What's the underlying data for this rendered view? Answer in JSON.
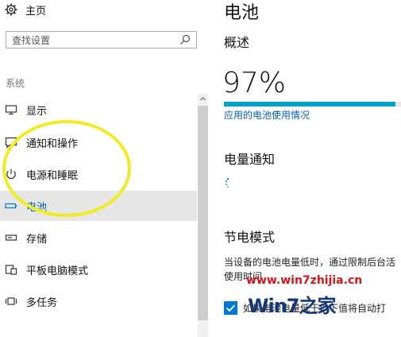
{
  "sidebar": {
    "home_label": "主页",
    "search_placeholder": "查找设置",
    "section_label": "系统",
    "items": [
      {
        "label": "显示",
        "icon": "monitor-icon"
      },
      {
        "label": "通知和操作",
        "icon": "notification-icon"
      },
      {
        "label": "电源和睡眠",
        "icon": "power-icon"
      },
      {
        "label": "电池",
        "icon": "battery-icon",
        "active": true
      },
      {
        "label": "存储",
        "icon": "storage-icon"
      },
      {
        "label": "平板电脑模式",
        "icon": "tablet-mode-icon"
      },
      {
        "label": "多任务",
        "icon": "multitasking-icon"
      }
    ]
  },
  "main": {
    "title": "电池",
    "overview_heading": "概述",
    "battery_percent": "97%",
    "battery_level": 0.97,
    "usage_link": "应用的电池使用情况",
    "notification_heading": "电量通知",
    "battery_saver_heading": "节电模式",
    "battery_saver_desc_line1": "当设备的电池电量低时，通过限制后台活",
    "battery_saver_desc_line2": "使用时间",
    "checkbox_label": "如果电池电量低于以下值将自动打"
  },
  "watermark": {
    "url": "www.win7zhijia.cn",
    "logo": "Win7之家"
  },
  "colors": {
    "accent": "#0078d7",
    "battery_bar": "#00a3c4",
    "link": "#0063b1",
    "highlight_circle": "#f2ea22"
  }
}
